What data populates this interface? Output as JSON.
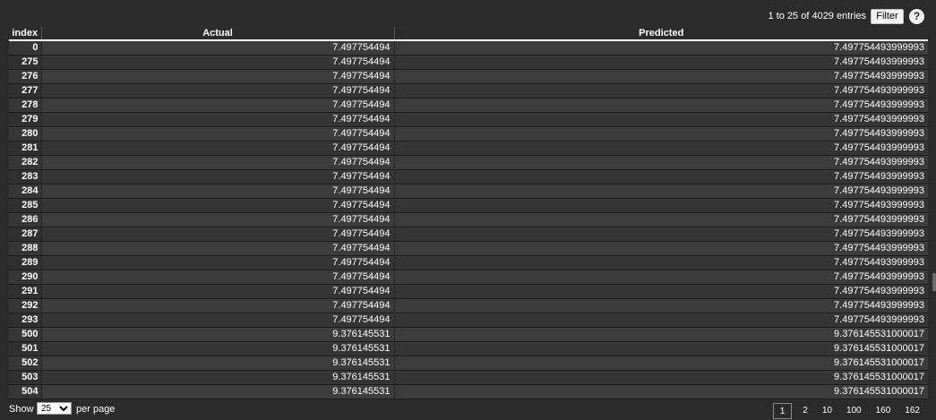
{
  "header": {
    "entries_info": "1 to 25 of 4029 entries",
    "filter_label": "Filter",
    "help_symbol": "?"
  },
  "table": {
    "columns": [
      "index",
      "Actual",
      "Predicted"
    ],
    "rows": [
      [
        "0",
        "7.497754494",
        "7.497754493999993"
      ],
      [
        "275",
        "7.497754494",
        "7.497754493999993"
      ],
      [
        "276",
        "7.497754494",
        "7.497754493999993"
      ],
      [
        "277",
        "7.497754494",
        "7.497754493999993"
      ],
      [
        "278",
        "7.497754494",
        "7.497754493999993"
      ],
      [
        "279",
        "7.497754494",
        "7.497754493999993"
      ],
      [
        "280",
        "7.497754494",
        "7.497754493999993"
      ],
      [
        "281",
        "7.497754494",
        "7.497754493999993"
      ],
      [
        "282",
        "7.497754494",
        "7.497754493999993"
      ],
      [
        "283",
        "7.497754494",
        "7.497754493999993"
      ],
      [
        "284",
        "7.497754494",
        "7.497754493999993"
      ],
      [
        "285",
        "7.497754494",
        "7.497754493999993"
      ],
      [
        "286",
        "7.497754494",
        "7.497754493999993"
      ],
      [
        "287",
        "7.497754494",
        "7.497754493999993"
      ],
      [
        "288",
        "7.497754494",
        "7.497754493999993"
      ],
      [
        "289",
        "7.497754494",
        "7.497754493999993"
      ],
      [
        "290",
        "7.497754494",
        "7.497754493999993"
      ],
      [
        "291",
        "7.497754494",
        "7.497754493999993"
      ],
      [
        "292",
        "7.497754494",
        "7.497754493999993"
      ],
      [
        "293",
        "7.497754494",
        "7.497754493999993"
      ],
      [
        "500",
        "9.376145531",
        "9.376145531000017"
      ],
      [
        "501",
        "9.376145531",
        "9.376145531000017"
      ],
      [
        "502",
        "9.376145531",
        "9.376145531000017"
      ],
      [
        "503",
        "9.376145531",
        "9.376145531000017"
      ],
      [
        "504",
        "9.376145531",
        "9.376145531000017"
      ]
    ]
  },
  "footer": {
    "show_label": "Show",
    "page_size": "25",
    "per_page_label": "per page",
    "pages": [
      "1",
      "2",
      "10",
      "100",
      "160",
      "162"
    ],
    "active_page": "1"
  },
  "colors": {
    "background": "#2b2b2b",
    "row_odd": "#3c3c3c",
    "row_even": "#353535",
    "text": "#ffffff"
  }
}
